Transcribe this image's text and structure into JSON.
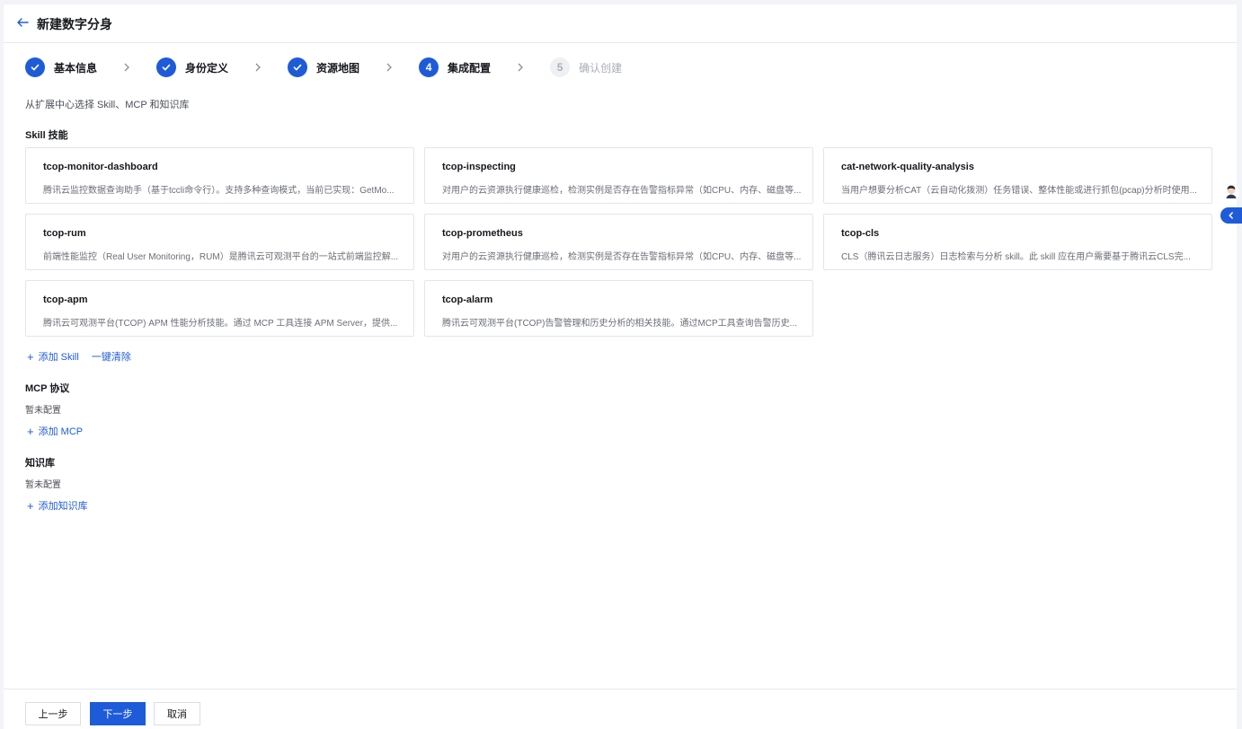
{
  "header": {
    "title": "新建数字分身"
  },
  "steps": [
    {
      "label": "基本信息",
      "state": "done"
    },
    {
      "label": "身份定义",
      "state": "done"
    },
    {
      "label": "资源地图",
      "state": "done"
    },
    {
      "label": "集成配置",
      "state": "active",
      "number": "4"
    },
    {
      "label": "确认创建",
      "state": "pending",
      "number": "5"
    }
  ],
  "subtitle": "从扩展中心选择 Skill、MCP 和知识库",
  "skill_section": {
    "title": "Skill 技能",
    "cards": [
      {
        "name": "tcop-monitor-dashboard",
        "desc": "腾讯云监控数据查询助手（基于tccli命令行）。支持多种查询模式，当前已实现：GetMo..."
      },
      {
        "name": "tcop-inspecting",
        "desc": "对用户的云资源执行健康巡检，检测实例是否存在告警指标异常（如CPU、内存、磁盘等..."
      },
      {
        "name": "cat-network-quality-analysis",
        "desc": "当用户想要分析CAT（云自动化拨测）任务错误、整体性能或进行抓包(pcap)分析时使用..."
      },
      {
        "name": "tcop-rum",
        "desc": "前端性能监控（Real User Monitoring，RUM）是腾讯云可观测平台的一站式前端监控解..."
      },
      {
        "name": "tcop-prometheus",
        "desc": "对用户的云资源执行健康巡检，检测实例是否存在告警指标异常（如CPU、内存、磁盘等..."
      },
      {
        "name": "tcop-cls",
        "desc": "CLS（腾讯云日志服务）日志检索与分析 skill。此 skill 应在用户需要基于腾讯云CLS完..."
      },
      {
        "name": "tcop-apm",
        "desc": "腾讯云可观测平台(TCOP) APM 性能分析技能。通过 MCP 工具连接 APM Server，提供..."
      },
      {
        "name": "tcop-alarm",
        "desc": "腾讯云可观测平台(TCOP)告警管理和历史分析的相关技能。通过MCP工具查询告警历史..."
      }
    ],
    "add_label": "添加 Skill",
    "clear_label": "一键清除"
  },
  "mcp_section": {
    "title": "MCP 协议",
    "empty_text": "暂未配置",
    "add_label": "添加 MCP"
  },
  "kb_section": {
    "title": "知识库",
    "empty_text": "暂未配置",
    "add_label": "添加知识库"
  },
  "footer": {
    "prev_label": "上一步",
    "next_label": "下一步",
    "cancel_label": "取消"
  },
  "colors": {
    "primary": "#1e5bd9",
    "border": "#e3e5e9"
  },
  "icons": [
    "back-arrow-icon",
    "check-icon",
    "chevron-right-icon",
    "plus-icon",
    "avatar-icon",
    "chevron-left-icon"
  ]
}
